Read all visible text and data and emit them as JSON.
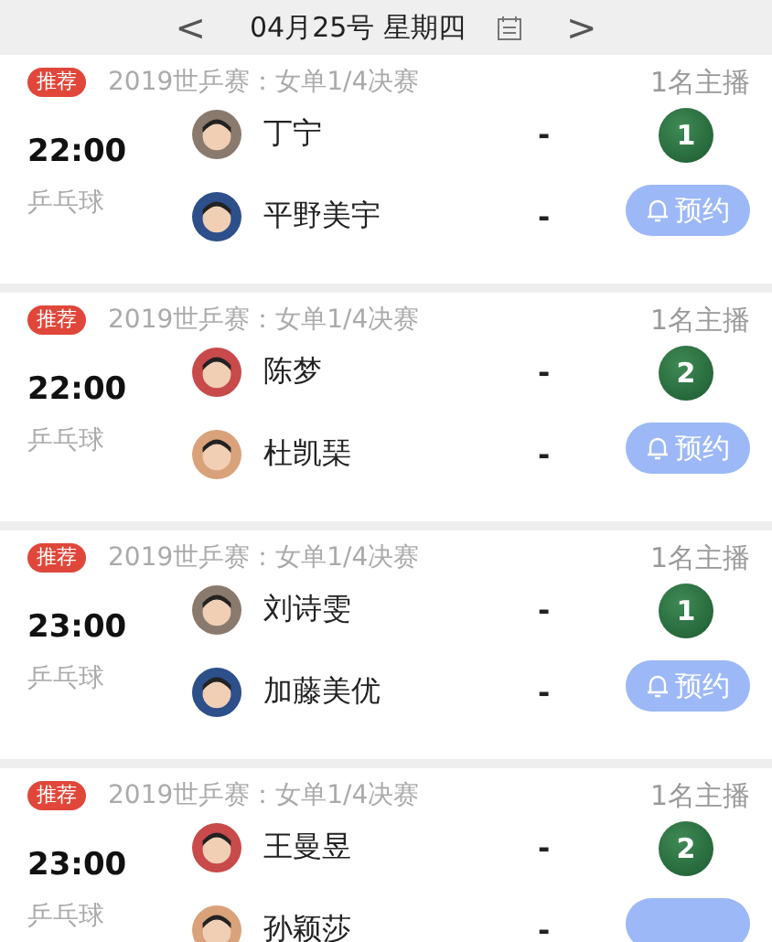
{
  "date_bar": {
    "prev": "<",
    "date": "04月25号 星期四",
    "next": ">"
  },
  "matches": [
    {
      "tag": "推荐",
      "title": "2019世乒赛：女单1/4决赛",
      "hosts": "1名主播",
      "time": "22:00",
      "sport": "乒乓球",
      "players": [
        {
          "name": "丁宁",
          "score": "-"
        },
        {
          "name": "平野美宇",
          "score": "-"
        }
      ],
      "channel": "1",
      "button": "预约"
    },
    {
      "tag": "推荐",
      "title": "2019世乒赛：女单1/4决赛",
      "hosts": "1名主播",
      "time": "22:00",
      "sport": "乒乓球",
      "players": [
        {
          "name": "陈梦",
          "score": "-"
        },
        {
          "name": "杜凯琹",
          "score": "-"
        }
      ],
      "channel": "2",
      "button": "预约"
    },
    {
      "tag": "推荐",
      "title": "2019世乒赛：女单1/4决赛",
      "hosts": "1名主播",
      "time": "23:00",
      "sport": "乒乓球",
      "players": [
        {
          "name": "刘诗雯",
          "score": "-"
        },
        {
          "name": "加藤美优",
          "score": "-"
        }
      ],
      "channel": "1",
      "button": "预约"
    },
    {
      "tag": "推荐",
      "title": "2019世乒赛：女单1/4决赛",
      "hosts": "1名主播",
      "time": "23:00",
      "sport": "乒乓球",
      "players": [
        {
          "name": "王曼昱",
          "score": "-"
        },
        {
          "name": "孙颖莎",
          "score": "-"
        }
      ],
      "channel": "2"
    }
  ]
}
